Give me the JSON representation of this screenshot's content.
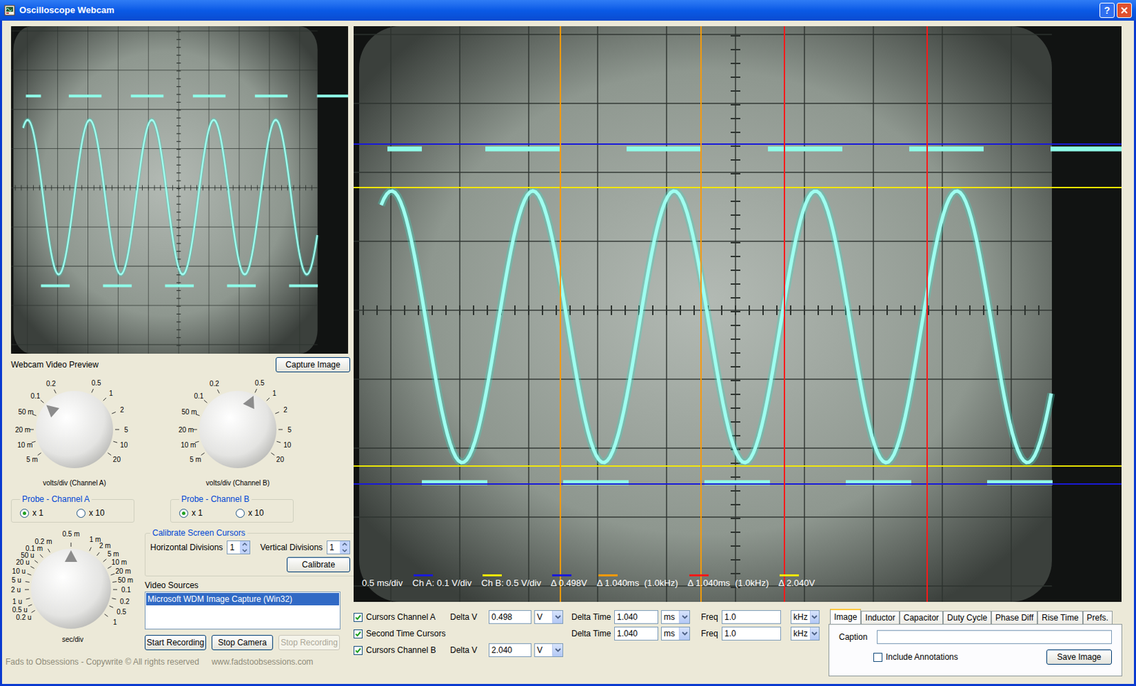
{
  "window": {
    "title": "Oscilloscope Webcam",
    "help": "?"
  },
  "preview": {
    "label": "Webcam Video Preview",
    "capture_button": "Capture Image"
  },
  "channel_knobs": [
    {
      "caption": "volts/div (Channel A)",
      "labels": [
        {
          "text": "5 m",
          "selected": false
        },
        {
          "text": "10 m",
          "selected": false
        },
        {
          "text": "20 m",
          "selected": false
        },
        {
          "text": "50 m",
          "selected": false
        },
        {
          "text": "0.1",
          "selected": true
        },
        {
          "text": "0.2",
          "selected": false
        },
        {
          "text": "0.5",
          "selected": false
        },
        {
          "text": "1",
          "selected": false
        },
        {
          "text": "2",
          "selected": false
        },
        {
          "text": "5",
          "selected": false
        },
        {
          "text": "10",
          "selected": false
        },
        {
          "text": "20",
          "selected": false
        }
      ]
    },
    {
      "caption": "volts/div (Channel B)",
      "labels": [
        {
          "text": "5 m",
          "selected": false
        },
        {
          "text": "10 m",
          "selected": false
        },
        {
          "text": "20 m",
          "selected": false
        },
        {
          "text": "50 m",
          "selected": false
        },
        {
          "text": "0.1",
          "selected": false
        },
        {
          "text": "0.2",
          "selected": false
        },
        {
          "text": "0.5",
          "selected": true
        },
        {
          "text": "1",
          "selected": false
        },
        {
          "text": "2",
          "selected": false
        },
        {
          "text": "5",
          "selected": false
        },
        {
          "text": "10",
          "selected": false
        },
        {
          "text": "20",
          "selected": false
        }
      ]
    }
  ],
  "probes": [
    {
      "title": "Probe - Channel A",
      "options": [
        {
          "label": "x 1",
          "selected": true
        },
        {
          "label": "x 10",
          "selected": false
        }
      ]
    },
    {
      "title": "Probe - Channel B",
      "options": [
        {
          "label": "x 1",
          "selected": true
        },
        {
          "label": "x 10",
          "selected": false
        }
      ]
    }
  ],
  "timebase_knob": {
    "caption": "sec/div",
    "labels": [
      {
        "text": "0.2 u",
        "selected": false
      },
      {
        "text": "0.5 u",
        "selected": false
      },
      {
        "text": "1 u",
        "selected": false
      },
      {
        "text": "2 u",
        "selected": false
      },
      {
        "text": "5 u",
        "selected": false
      },
      {
        "text": "10 u",
        "selected": false
      },
      {
        "text": "20 u",
        "selected": false
      },
      {
        "text": "50 u",
        "selected": false
      },
      {
        "text": "0.1 m",
        "selected": false
      },
      {
        "text": "0.2 m",
        "selected": false
      },
      {
        "text": "0.5 m",
        "selected": true
      },
      {
        "text": "1 m",
        "selected": false
      },
      {
        "text": "2 m",
        "selected": false
      },
      {
        "text": "5 m",
        "selected": false
      },
      {
        "text": "10 m",
        "selected": false
      },
      {
        "text": "20 m",
        "selected": false
      },
      {
        "text": "50 m",
        "selected": false
      },
      {
        "text": "0.1",
        "selected": false
      },
      {
        "text": "0.2",
        "selected": false
      },
      {
        "text": "0.5",
        "selected": false
      },
      {
        "text": "1",
        "selected": false
      }
    ]
  },
  "calibrate": {
    "title": "Calibrate Screen Cursors",
    "horizontal_label": "Horizontal Divisions",
    "horizontal_value": "1",
    "vertical_label": "Vertical Divisions",
    "vertical_value": "1",
    "button": "Calibrate"
  },
  "video_sources": {
    "label": "Video Sources",
    "items": [
      {
        "text": "Microsoft WDM Image Capture (Win32)",
        "selected": true
      }
    ]
  },
  "recording_buttons": [
    {
      "label": "Start Recording",
      "disabled": false
    },
    {
      "label": "Stop Camera",
      "disabled": false
    },
    {
      "label": "Stop Recording",
      "disabled": true
    }
  ],
  "footer": {
    "copyright": "Fads to Obsessions - Copywrite © All rights reserved",
    "url": "www.fadstoobsessions.com"
  },
  "scope": {
    "timebase": "0.5 ms/div",
    "annotations": [
      {
        "text": "Ch A: 0.1 V/div",
        "color": "#1a1ad8"
      },
      {
        "text": "Ch B: 0.5 V/div",
        "color": "#f2e600"
      },
      {
        "text": "Δ 0.498V",
        "color": "#1a1ad8"
      },
      {
        "text": "Δ 1.040ms  (1.0kHz)",
        "color": "#ff9a00"
      },
      {
        "text": "Δ 1.040ms  (1.0kHz)",
        "color": "#ff1a1a"
      },
      {
        "text": "Δ 2.040V",
        "color": "#f2e600"
      }
    ]
  },
  "cursor_rows": [
    {
      "label": "Cursors Channel A",
      "checked": true,
      "fields": [
        {
          "kind": "voltage",
          "label": "Delta V",
          "value": "0.498",
          "unit": "V"
        },
        {
          "kind": "time",
          "label": "Delta Time",
          "value": "1.040",
          "unit": "ms"
        },
        {
          "kind": "freq",
          "label": "Freq",
          "value": "1.0",
          "unit": "kHz"
        }
      ]
    },
    {
      "label": "Second Time Cursors",
      "checked": true,
      "fields": [
        {
          "kind": "time",
          "label": "Delta Time",
          "value": "1.040",
          "unit": "ms"
        },
        {
          "kind": "freq",
          "label": "Freq",
          "value": "1.0",
          "unit": "kHz"
        }
      ]
    },
    {
      "label": "Cursors Channel B",
      "checked": true,
      "fields": [
        {
          "kind": "voltage",
          "label": "Delta V",
          "value": "2.040",
          "unit": "V"
        }
      ]
    }
  ],
  "tools": {
    "tabs": [
      {
        "label": "Image",
        "selected": true
      },
      {
        "label": "Inductor",
        "selected": false
      },
      {
        "label": "Capacitor",
        "selected": false
      },
      {
        "label": "Duty Cycle",
        "selected": false
      },
      {
        "label": "Phase Diff",
        "selected": false
      },
      {
        "label": "Rise Time",
        "selected": false
      },
      {
        "label": "Prefs.",
        "selected": false
      }
    ],
    "caption_label": "Caption",
    "caption_value": "",
    "include_annotations": {
      "label": "Include Annotations",
      "checked": false
    },
    "save_button": "Save Image"
  }
}
